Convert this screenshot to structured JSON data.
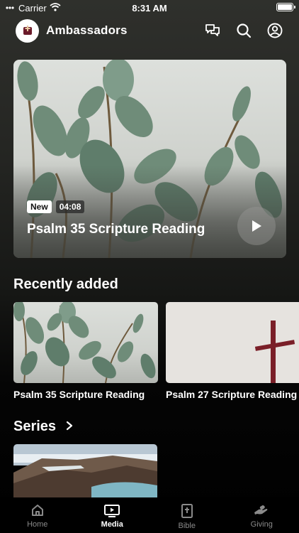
{
  "status_bar": {
    "carrier": "Carrier",
    "time": "8:31 AM"
  },
  "header": {
    "org_name": "Ambassadors"
  },
  "hero": {
    "badge_new": "New",
    "duration": "04:08",
    "title": "Psalm 35 Scripture Reading"
  },
  "recently_added": {
    "title": "Recently added",
    "items": [
      {
        "label": "Psalm 35 Scripture Reading"
      },
      {
        "label": "Psalm 27 Scripture Reading"
      }
    ]
  },
  "series": {
    "title": "Series"
  },
  "tabs": [
    {
      "label": "Home",
      "icon": "home-icon",
      "active": false
    },
    {
      "label": "Media",
      "icon": "media-icon",
      "active": true
    },
    {
      "label": "Bible",
      "icon": "bible-icon",
      "active": false
    },
    {
      "label": "Giving",
      "icon": "giving-icon",
      "active": false
    }
  ],
  "colors": {
    "background_top": "#2f302c",
    "background_bottom": "#000000",
    "accent_cross": "#7a1f28"
  }
}
